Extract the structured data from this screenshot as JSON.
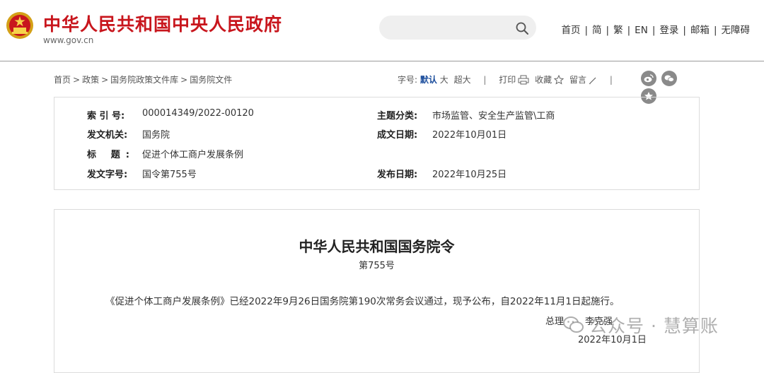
{
  "header": {
    "site_title": "中华人民共和国中央人民政府",
    "site_url": "www.gov.cn",
    "search": {
      "placeholder": ""
    },
    "nav": [
      {
        "label": "首页"
      },
      {
        "label": "简"
      },
      {
        "label": "繁"
      },
      {
        "label": "EN"
      },
      {
        "label": "登录"
      },
      {
        "label": "邮箱"
      },
      {
        "label": "无障碍"
      }
    ]
  },
  "breadcrumb": [
    {
      "label": "首页"
    },
    {
      "label": "政策"
    },
    {
      "label": "国务院政策文件库"
    },
    {
      "label": "国务院文件"
    }
  ],
  "tools": {
    "font_size_label": "字号:",
    "font_default": "默认",
    "font_large": "大",
    "font_xlarge": "超大",
    "print": "打印",
    "favorite": "收藏",
    "comment": "留言"
  },
  "meta": {
    "index_label": "索 引 号:",
    "index_value": "000014349/2022-00120",
    "topic_label": "主题分类:",
    "topic_value": "市场监管、安全生产监管\\工商",
    "issuer_label": "发文机关:",
    "issuer_value": "国务院",
    "created_label": "成文日期:",
    "created_value": "2022年10月01日",
    "title_label": "标 题:",
    "title_value": "促进个体工商户发展条例",
    "docno_label": "发文字号:",
    "docno_value": "国令第755号",
    "published_label": "发布日期:",
    "published_value": "2022年10月25日"
  },
  "document": {
    "title": "中华人民共和国国务院令",
    "number": "第755号",
    "body": "《促进个体工商户发展条例》已经2022年9月26日国务院第190次常务会议通过，现予公布，自2022年11月1日起施行。",
    "sign_title": "总理",
    "sign_name": "李克强",
    "date": "2022年10月1日"
  },
  "watermark": {
    "text": "公众号 · 慧算账"
  },
  "colors": {
    "brand_red": "#c8161d",
    "active_blue": "#1b4d9c",
    "icon_gray": "#8a8a8a"
  }
}
